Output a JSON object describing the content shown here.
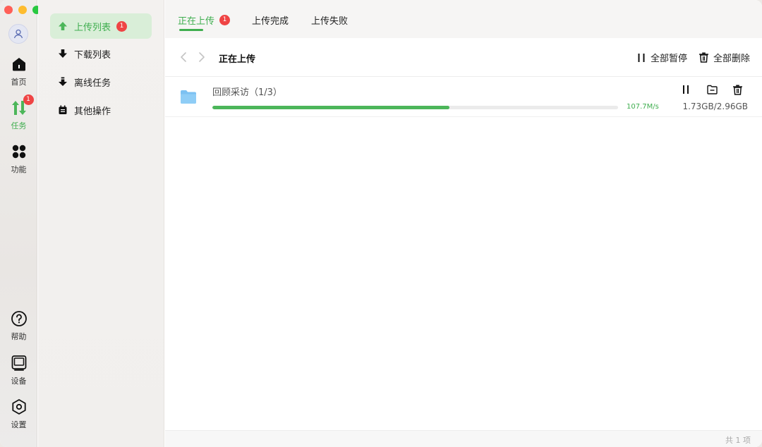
{
  "rail": {
    "items": [
      {
        "label": "首页",
        "icon": "home-icon"
      },
      {
        "label": "任务",
        "icon": "transfer-icon",
        "badge": "1"
      },
      {
        "label": "功能",
        "icon": "apps-icon"
      }
    ],
    "bottom": [
      {
        "label": "帮助",
        "icon": "help-icon"
      },
      {
        "label": "设备",
        "icon": "device-icon"
      },
      {
        "label": "设置",
        "icon": "settings-icon"
      }
    ]
  },
  "sidebar": {
    "items": [
      {
        "label": "上传列表",
        "badge": "1",
        "icon": "upload-arrow-icon"
      },
      {
        "label": "下载列表",
        "icon": "download-arrow-icon"
      },
      {
        "label": "离线任务",
        "icon": "offline-download-icon"
      },
      {
        "label": "其他操作",
        "icon": "calendar-icon"
      }
    ]
  },
  "tabs": [
    {
      "label": "正在上传",
      "badge": "1"
    },
    {
      "label": "上传完成"
    },
    {
      "label": "上传失败"
    }
  ],
  "toolbar": {
    "title": "正在上传",
    "pause_all": "全部暂停",
    "delete_all": "全部删除"
  },
  "task": {
    "name": "回顾采访（1/3）",
    "progress": 0.584,
    "speed": "107.7M/s",
    "size": "1.73GB/2.96GB"
  },
  "footer": {
    "count": "共 1 项"
  },
  "colors": {
    "accent": "#3fae4f",
    "badge": "#ef4444",
    "folder": "#7cc1f2"
  }
}
